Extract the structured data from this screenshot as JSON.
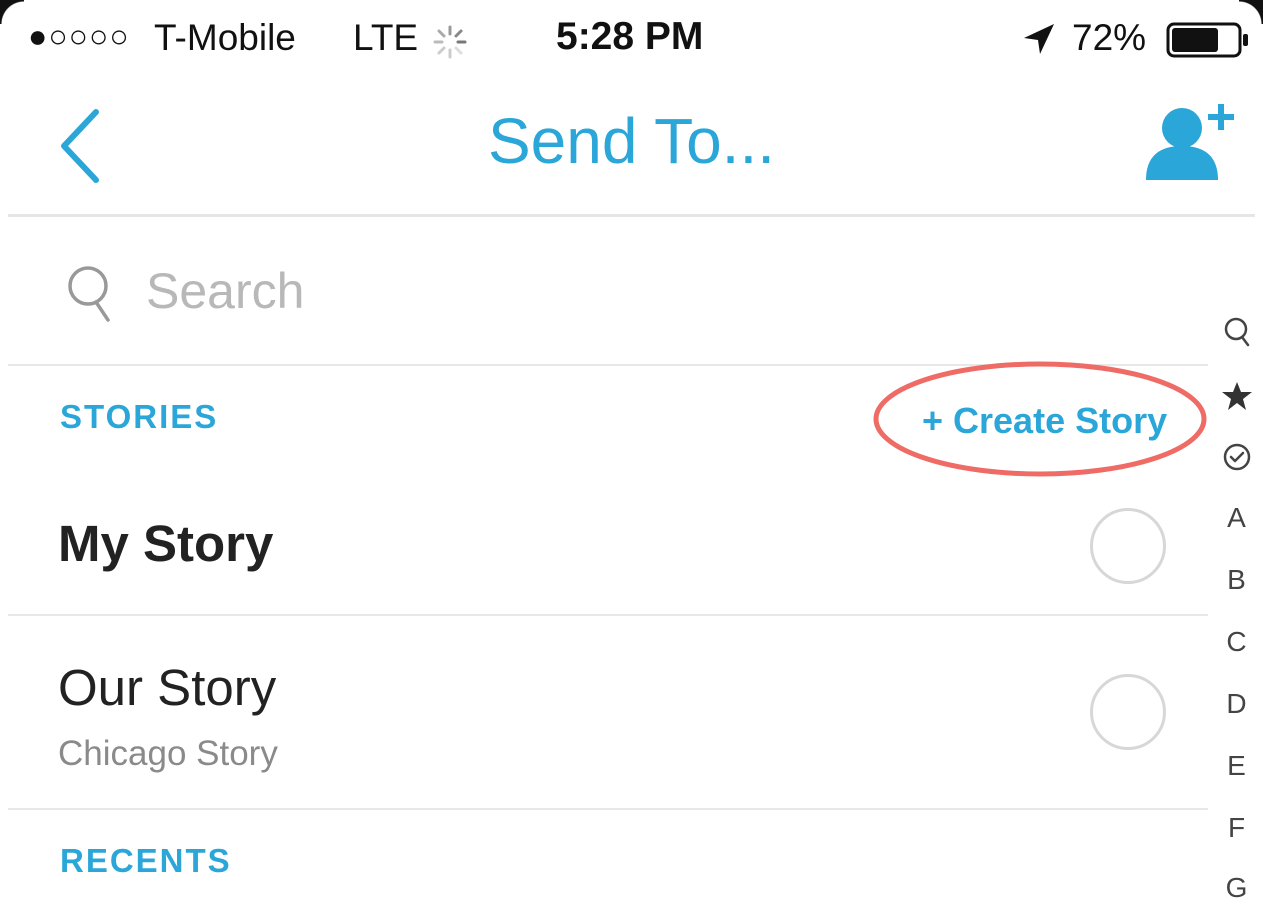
{
  "status_bar": {
    "signal": "●○○○○",
    "carrier": "T-Mobile",
    "network": "LTE",
    "activity_icon": "spinner-icon",
    "time": "5:28 PM",
    "location_icon": "location-arrow-icon",
    "battery_percent": "72%",
    "battery_level": 0.72,
    "battery_icon": "battery-icon"
  },
  "header": {
    "back_icon": "chevron-left-icon",
    "title": "Send To...",
    "add_friend_icon": "add-friend-icon"
  },
  "search": {
    "placeholder": "Search",
    "icon": "search-icon"
  },
  "stories": {
    "label": "STORIES",
    "create_label": "+ Create Story",
    "items": [
      {
        "title": "My Story",
        "subtitle": ""
      },
      {
        "title": "Our Story",
        "subtitle": "Chicago Story"
      }
    ]
  },
  "recents": {
    "label": "RECENTS"
  },
  "index_bar": {
    "icons": [
      "search-icon",
      "star-icon",
      "clock-check-icon"
    ],
    "letters": [
      "A",
      "B",
      "C",
      "D",
      "E",
      "F",
      "G"
    ]
  },
  "colors": {
    "accent": "#2aa6d8",
    "highlight": "#ef6b66",
    "text": "#222222",
    "muted": "#8a8a8a"
  }
}
